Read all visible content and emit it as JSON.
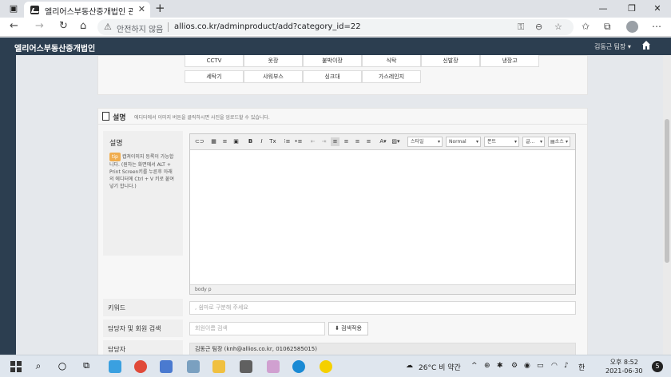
{
  "browser": {
    "tab_title": "엘리어스부동산중개법인 관리자",
    "insecure_label": "안전하지 않음",
    "url": "allios.co.kr/adminproduct/add?category_id=22"
  },
  "app": {
    "title": "엘리어스부동산중개법인",
    "user_menu": "김동근 팀장 ▾"
  },
  "options": {
    "row1": [
      "CCTV",
      "옷장",
      "붙박이장",
      "식탁",
      "신발장",
      "냉장고"
    ],
    "row2": [
      "세탁기",
      "샤워부스",
      "싱크대",
      "가스레인지"
    ]
  },
  "description": {
    "section_title": "설명",
    "section_hint": "에디터에서 이미지 버튼을 클릭하시면 사진을 업로드할 수 있습니다.",
    "label": "설명",
    "tip_badge": "tip",
    "tip_text": "캡쳐이미지 등록이 가능합니다. (원하는 화면에서 ALT + Print Screen키를 누른후 아래의 에디터에 Ctrl + V 키로 붙여넣기 합니다.)",
    "editor": {
      "style_select": "스타일",
      "format_select": "Normal",
      "font_select": "폰트",
      "size_select": "글...",
      "source_btn": "소스",
      "status": "body  p"
    }
  },
  "keywords": {
    "label": "키워드",
    "placeholder": ", 쉼마로 구분해 주세요"
  },
  "manager_search": {
    "label": "담당자 및 회원 검색",
    "placeholder": "회원이름 검색",
    "apply_btn": "검색적용"
  },
  "manager": {
    "label": "담당자",
    "value": "김동근 팀장 (knh@allios.co.kr, 01062585015)"
  },
  "taskbar": {
    "weather": "26°C 비 약간",
    "ime": "한",
    "time": "오후 8:52",
    "date": "2021-06-30",
    "notif_count": "5"
  }
}
